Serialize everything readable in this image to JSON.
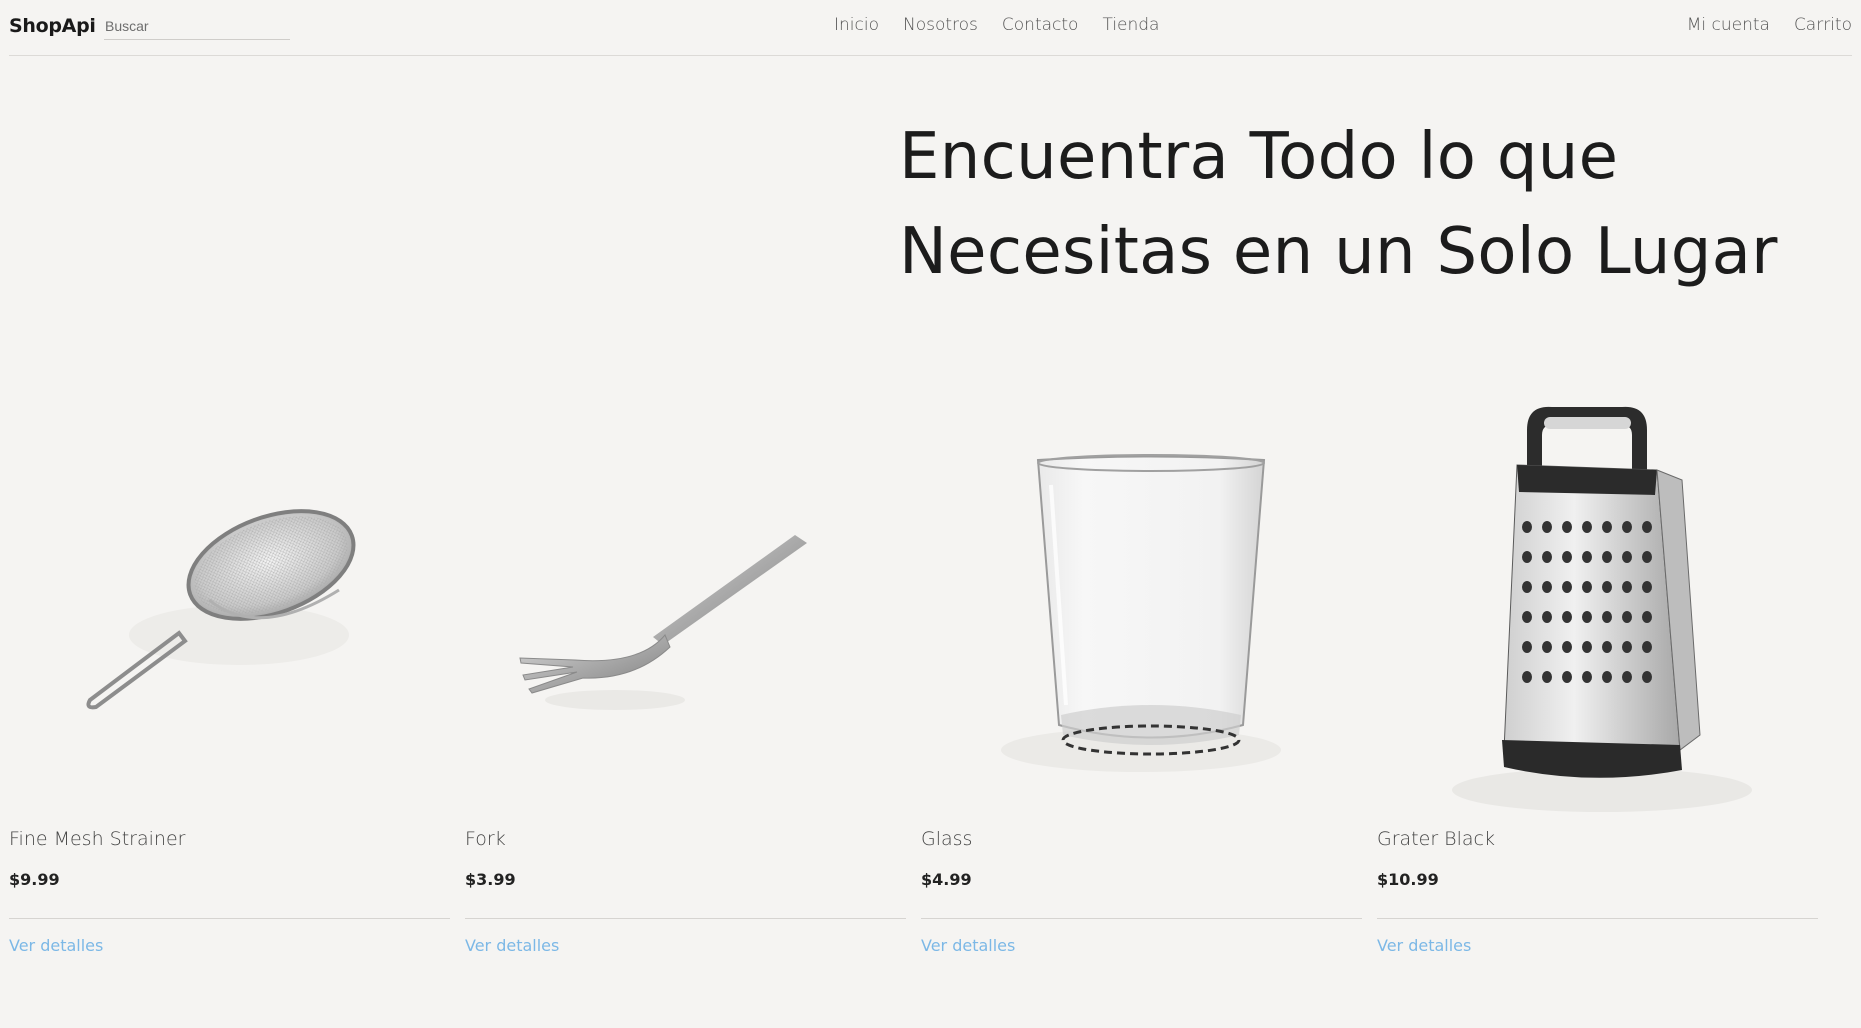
{
  "header": {
    "brand": "ShopApi",
    "search": {
      "placeholder": "Buscar",
      "value": ""
    },
    "nav": [
      "Inicio",
      "Nosotros",
      "Contacto",
      "Tienda"
    ],
    "account": "Mi cuenta",
    "cart": "Carrito"
  },
  "hero": {
    "line1": "Encuentra Todo lo que",
    "line2": "Necesitas en un Solo Lugar"
  },
  "products": [
    {
      "name": "Fine Mesh Strainer",
      "price": "$9.99",
      "details": "Ver detalles",
      "icon": "strainer-icon"
    },
    {
      "name": "Fork",
      "price": "$3.99",
      "details": "Ver detalles",
      "icon": "fork-icon"
    },
    {
      "name": "Glass",
      "price": "$4.99",
      "details": "Ver detalles",
      "icon": "glass-icon"
    },
    {
      "name": "Grater Black",
      "price": "$10.99",
      "details": "Ver detalles",
      "icon": "grater-icon"
    }
  ],
  "colors": {
    "background": "#f5f4f2",
    "link": "#7cb8e6",
    "text": "#222222"
  }
}
